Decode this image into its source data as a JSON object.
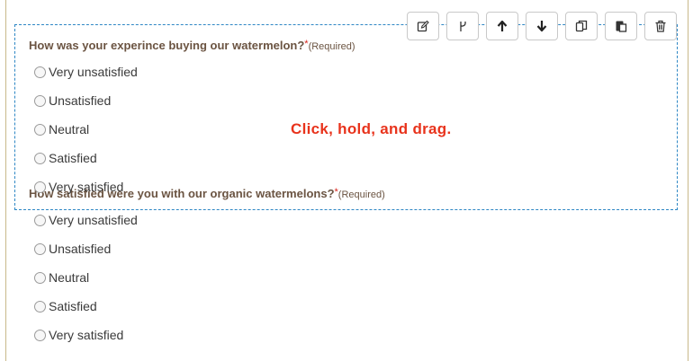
{
  "questions": [
    {
      "title": "How was your experince buying our watermelon?",
      "required_star": "*",
      "required_label": "(Required)",
      "options": [
        "Very unsatisfied",
        "Unsatisfied",
        "Neutral",
        "Satisfied",
        "Very satisfied"
      ]
    },
    {
      "title": "How satisfied were you with our organic watermelons?",
      "required_star": "*",
      "required_label": "(Required)",
      "options": [
        "Very unsatisfied",
        "Unsatisfied",
        "Neutral",
        "Satisfied",
        "Very satisfied"
      ]
    }
  ],
  "drag_hint": "Click, hold, and drag.",
  "toolbar": {
    "buttons": [
      {
        "icon": "edit-icon"
      },
      {
        "icon": "branch-icon"
      },
      {
        "icon": "arrow-up-icon"
      },
      {
        "icon": "arrow-down-icon"
      },
      {
        "icon": "duplicate-icon"
      },
      {
        "icon": "paste-icon"
      },
      {
        "icon": "trash-icon"
      }
    ]
  },
  "colors": {
    "question_text": "#6b5442",
    "required_star": "#d9251d",
    "drag_hint": "#e8331c",
    "selection_border": "#2d86c4"
  }
}
